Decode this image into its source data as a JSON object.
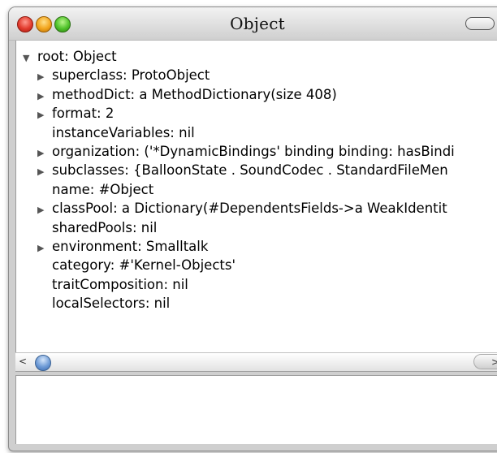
{
  "window": {
    "title": "Object"
  },
  "tree": [
    {
      "text": "root: Object",
      "expander": "expanded",
      "level": 0
    },
    {
      "text": "superclass: ProtoObject",
      "expander": "collapsed",
      "level": 1
    },
    {
      "text": "methodDict: a MethodDictionary(size 408)",
      "expander": "collapsed",
      "level": 1
    },
    {
      "text": "format: 2",
      "expander": "collapsed",
      "level": 1
    },
    {
      "text": "instanceVariables: nil",
      "expander": "none",
      "level": 1
    },
    {
      "text": "organization: ('*DynamicBindings' binding binding: hasBindi",
      "expander": "collapsed",
      "level": 1
    },
    {
      "text": "subclasses: {BalloonState . SoundCodec . StandardFileMen",
      "expander": "collapsed",
      "level": 1
    },
    {
      "text": "name: #Object",
      "expander": "none",
      "level": 1
    },
    {
      "text": "classPool: a Dictionary(#DependentsFields->a WeakIdentit",
      "expander": "collapsed",
      "level": 1
    },
    {
      "text": "sharedPools: nil",
      "expander": "none",
      "level": 1
    },
    {
      "text": "environment: Smalltalk",
      "expander": "collapsed",
      "level": 1
    },
    {
      "text": "category: #'Kernel-Objects'",
      "expander": "none",
      "level": 1
    },
    {
      "text": "traitComposition: nil",
      "expander": "none",
      "level": 1
    },
    {
      "text": "localSelectors: nil",
      "expander": "none",
      "level": 1
    }
  ],
  "scrollbar": {
    "left_arrow": "<",
    "right_arrow": ">",
    "position": 0
  },
  "icons": {
    "expanded": "triangle-down-icon",
    "collapsed": "triangle-right-icon"
  },
  "colors": {
    "close": "#e23b2d",
    "minimize": "#f2a51d",
    "zoom": "#4fc22a",
    "scroll_thumb": "#6e9bd6"
  }
}
